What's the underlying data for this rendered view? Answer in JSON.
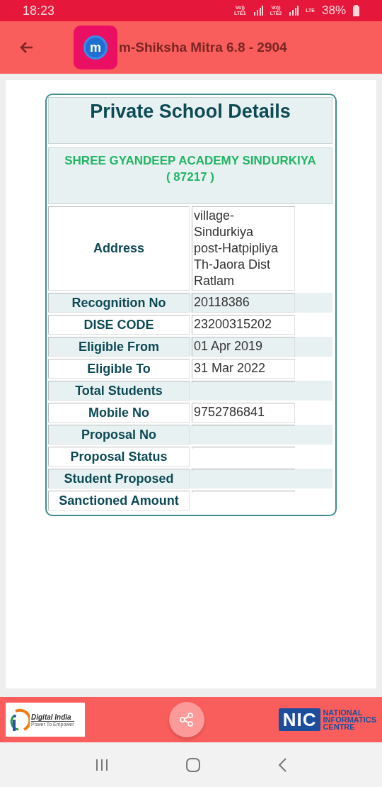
{
  "status_bar": {
    "time": "18:23",
    "sims": [
      {
        "top": "Vo))",
        "bottom": "LTE1"
      },
      {
        "top": "Vo))",
        "bottom": "LTE2"
      }
    ],
    "data_label": "LTE",
    "battery": "38%"
  },
  "app_bar": {
    "title": "m-Shiksha Mitra 6.8 - 2904",
    "logo_letter": "m"
  },
  "card": {
    "title": "Private School Details",
    "school_name": "SHREE GYANDEEP ACADEMY SINDURKIYA",
    "school_code": "( 87217 )",
    "rows": [
      {
        "label": "Address",
        "value": "village-\nSindurkiya\npost-Hatpipliya\nTh-Jaora Dist\nRatlam"
      },
      {
        "label": "Recognition No",
        "value": "20118386"
      },
      {
        "label": "DISE CODE",
        "value": "23200315202"
      },
      {
        "label": "Eligible From",
        "value": "01 Apr 2019"
      },
      {
        "label": "Eligible To",
        "value": "31 Mar 2022"
      },
      {
        "label": "Total Students"
      },
      {
        "label": "Mobile No",
        "value": "9752786841"
      },
      {
        "label": "Proposal No"
      },
      {
        "label": "Proposal Status"
      },
      {
        "label": "Student Proposed"
      },
      {
        "label": "Sanctioned Amount"
      }
    ]
  },
  "footer": {
    "digital_india": {
      "name": "Digital India",
      "tagline": "Power To Empower"
    },
    "nic": {
      "letters": "NIC",
      "lines": [
        "NATIONAL",
        "INFORMATICS",
        "CENTRE"
      ]
    }
  }
}
